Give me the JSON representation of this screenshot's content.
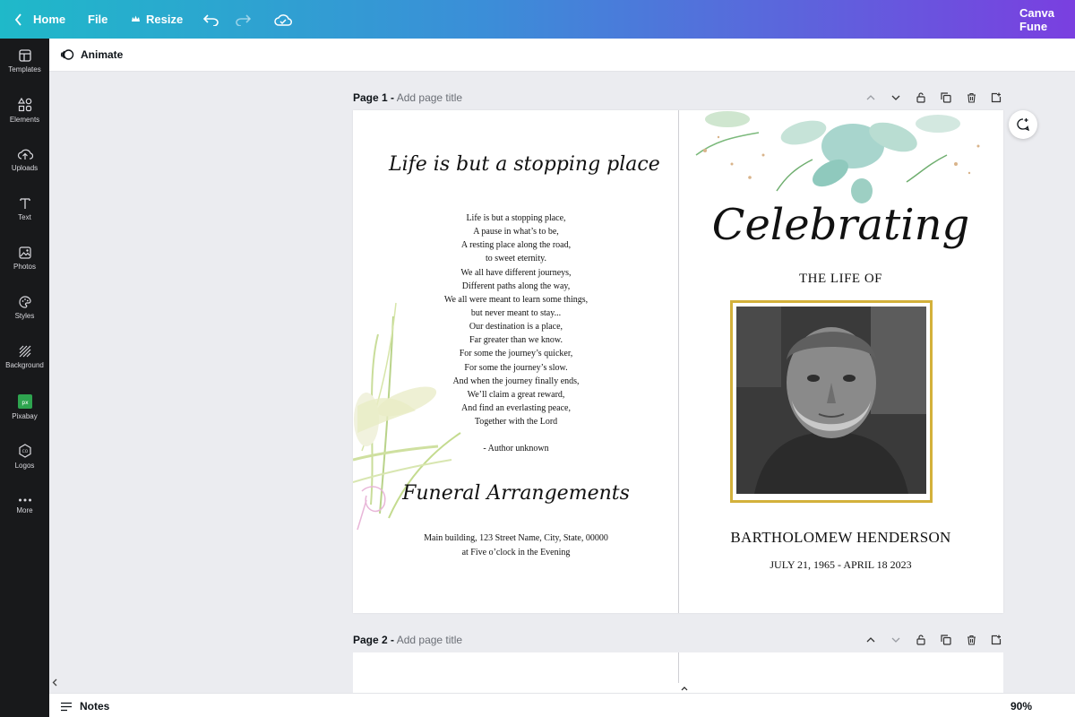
{
  "topbar": {
    "home_label": "Home",
    "file_label": "File",
    "resize_label": "Resize",
    "project_title": "Canva Fune"
  },
  "sidebar": {
    "items": [
      {
        "label": "Templates",
        "icon": "templates-icon"
      },
      {
        "label": "Elements",
        "icon": "elements-icon"
      },
      {
        "label": "Uploads",
        "icon": "upload-icon"
      },
      {
        "label": "Text",
        "icon": "text-icon"
      },
      {
        "label": "Photos",
        "icon": "photos-icon"
      },
      {
        "label": "Styles",
        "icon": "palette-icon"
      },
      {
        "label": "Background",
        "icon": "background-icon"
      },
      {
        "label": "Pixabay",
        "icon": "pixabay-icon"
      },
      {
        "label": "Logos",
        "icon": "logos-icon"
      },
      {
        "label": "More",
        "icon": "more-icon"
      }
    ]
  },
  "subbar": {
    "animate_label": "Animate"
  },
  "pages": [
    {
      "number_label": "Page 1 -",
      "title_placeholder": "Add page title"
    },
    {
      "number_label": "Page 2 -",
      "title_placeholder": "Add page title"
    }
  ],
  "design": {
    "left": {
      "heading_script": "Life is but a stopping place",
      "poem_lines": [
        "Life is but a stopping place,",
        "A pause in what’s to be,",
        "A resting place along the road,",
        "to sweet eternity.",
        "We all have different journeys,",
        "Different paths along the way,",
        "We all were meant to learn some things,",
        "but never meant to stay...",
        "Our destination is a place,",
        "Far greater than we know.",
        "For some the journey’s quicker,",
        "For some the journey’s slow.",
        "And when the journey finally ends,",
        "We’ll claim a great reward,",
        "And find an everlasting peace,",
        "Together with the Lord",
        "",
        "- Author unknown"
      ],
      "arrangements_script": "Funeral Arrangements",
      "arrangements_line1": "Main building, 123 Street Name, City, State, 00000",
      "arrangements_line2": "at Five o’clock in the Evening"
    },
    "right": {
      "celebrating_script": "Celebrating",
      "the_life_of": "THE LIFE OF",
      "name": "BARTHOLOMEW HENDERSON",
      "dates": "JULY 21, 1965 - APRIL 18 2023"
    }
  },
  "bottombar": {
    "notes_label": "Notes",
    "zoom_level": "90%"
  },
  "colors": {
    "gold_frame": "#d3b13b",
    "rail_bg": "#18191b",
    "gradient_start": "#1fb9c9",
    "gradient_end": "#7a3fe0"
  }
}
